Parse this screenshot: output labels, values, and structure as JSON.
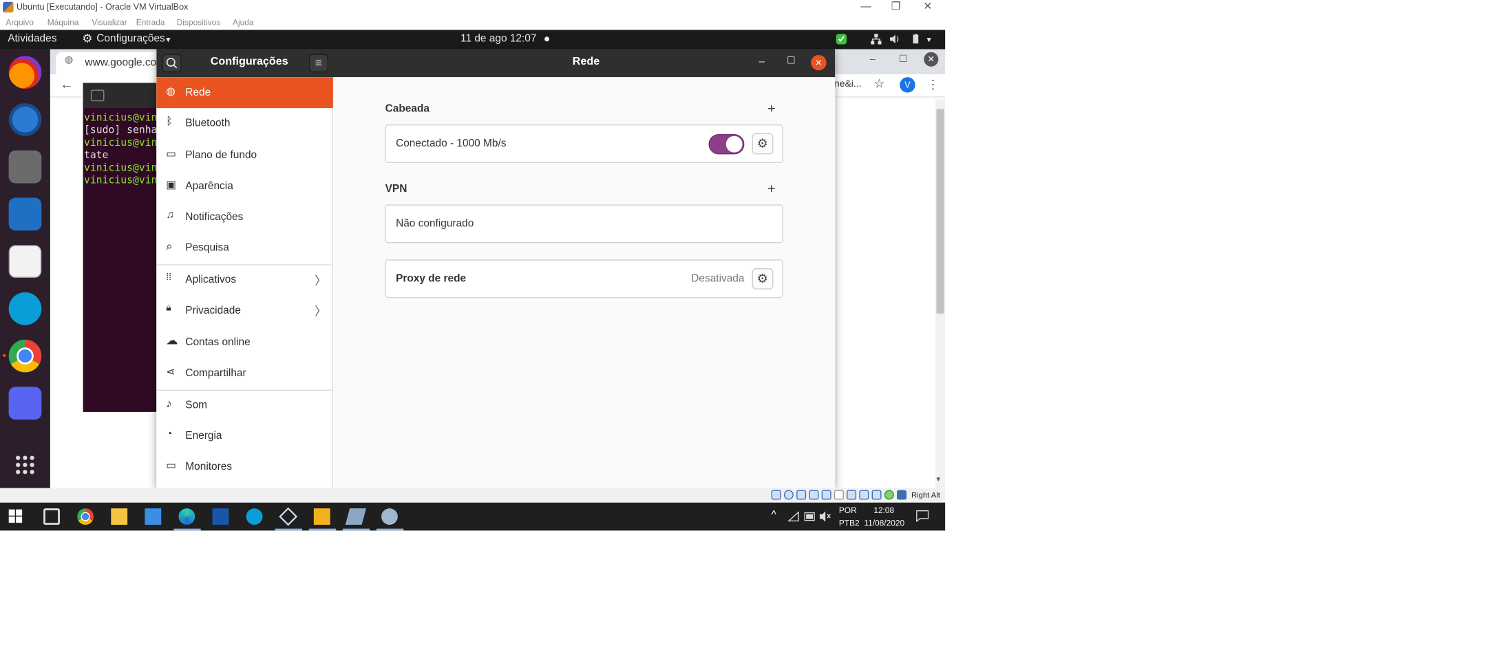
{
  "host": {
    "title": "Ubuntu [Executando] - Oracle VM VirtualBox",
    "controls": [
      "—",
      "❐",
      "✕"
    ],
    "menu": [
      "Arquivo",
      "Máquina",
      "Visualizar",
      "Entrada",
      "Dispositivos",
      "Ajuda"
    ]
  },
  "ubuntu_topbar": {
    "activities": "Atividades",
    "app_menu": "Configurações",
    "app_menu_arrow": "▾",
    "datetime": "11 de ago  12:07"
  },
  "browser": {
    "tab_title": "www.google.co",
    "partial_text": "ne&i...",
    "avatar_letter": "V",
    "back_icon": "←",
    "star_icon": "☆",
    "menu_icon": "⋮",
    "scroll_down": "▾"
  },
  "terminal": {
    "lines": [
      "vinicius@vin",
      "[sudo] senha",
      "vinicius@vin",
      "tate",
      "vinicius@vin",
      "vinicius@vin"
    ]
  },
  "settings": {
    "header_left": "Configurações",
    "header_title": "Rede",
    "search_icon": "search-icon",
    "window_controls": [
      "–",
      "☐",
      "✕"
    ],
    "menu_glyph": "≡",
    "sidebar": [
      {
        "label": "Rede",
        "icon": "network-icon",
        "glyph": "◍",
        "active": true
      },
      {
        "label": "Bluetooth",
        "icon": "bluetooth-icon",
        "glyph": "ᛒ"
      },
      {
        "label": "Plano de fundo",
        "icon": "background-icon",
        "glyph": "▭"
      },
      {
        "label": "Aparência",
        "icon": "appearance-icon",
        "glyph": "▣"
      },
      {
        "label": "Notificações",
        "icon": "bell-icon",
        "glyph": "♫"
      },
      {
        "label": "Pesquisa",
        "icon": "search-icon",
        "glyph": "⌕"
      },
      {
        "label": "Aplicativos",
        "icon": "apps-icon",
        "glyph": "⁞⁞",
        "chevron": "〉"
      },
      {
        "label": "Privacidade",
        "icon": "lock-icon",
        "glyph": "🔒︎",
        "chevron": "〉"
      },
      {
        "label": "Contas online",
        "icon": "cloud-icon",
        "glyph": "☁"
      },
      {
        "label": "Compartilhar",
        "icon": "share-icon",
        "glyph": "⋖"
      },
      {
        "label": "Som",
        "icon": "music-icon",
        "glyph": "♪"
      },
      {
        "label": "Energia",
        "icon": "power-icon",
        "glyph": "◔"
      },
      {
        "label": "Monitores",
        "icon": "monitor-icon",
        "glyph": "▭"
      }
    ],
    "wired": {
      "heading": "Cabeada",
      "add": "+",
      "status": "Conectado - 1000 Mb/s",
      "toggle_on": true,
      "gear_glyph": "⚙"
    },
    "vpn": {
      "heading": "VPN",
      "add": "+",
      "status": "Não configurado"
    },
    "proxy": {
      "label": "Proxy de rede",
      "value": "Desativada",
      "gear_glyph": "⚙"
    }
  },
  "vm_status": {
    "host_key": "Right Alt"
  },
  "taskbar": {
    "lang_line1": "POR",
    "lang_line2": "PTB2",
    "time": "12:08",
    "date": "11/08/2020",
    "tray_chevron": "^"
  },
  "colors": {
    "accent": "#e95420",
    "toggle": "#8f3f8a",
    "dock": "#2c1f2b",
    "terminal": "#300a24"
  }
}
